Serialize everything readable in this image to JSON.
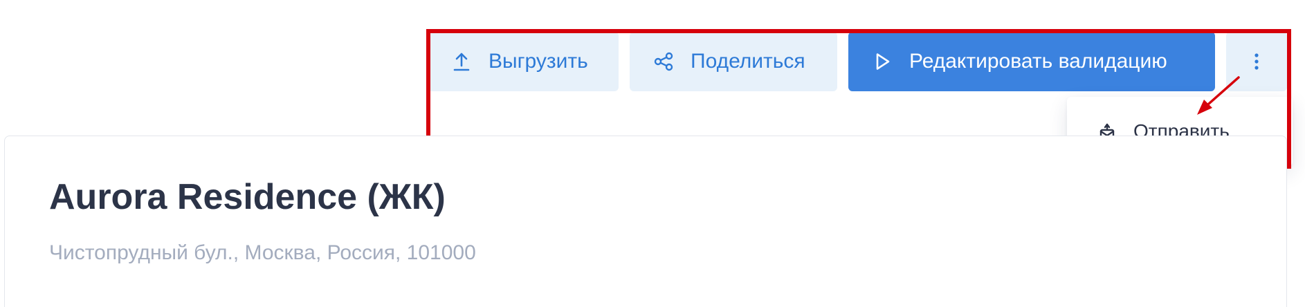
{
  "toolbar": {
    "export_label": "Выгрузить",
    "share_label": "Поделиться",
    "edit_label": "Редактировать валидацию"
  },
  "menu": {
    "items": [
      {
        "label": "Отправить",
        "icon": "send-box-icon"
      }
    ]
  },
  "property": {
    "title": "Aurora Residence (ЖК)",
    "address": "Чистопрудный бул., Москва, Россия, 101000"
  },
  "colors": {
    "primary": "#3b82df",
    "light_button_bg": "#e7f1fa",
    "light_button_text": "#2d7ad7",
    "annotation": "#d6000b",
    "title_text": "#2c3448",
    "subtitle_text": "#a3acbe"
  }
}
